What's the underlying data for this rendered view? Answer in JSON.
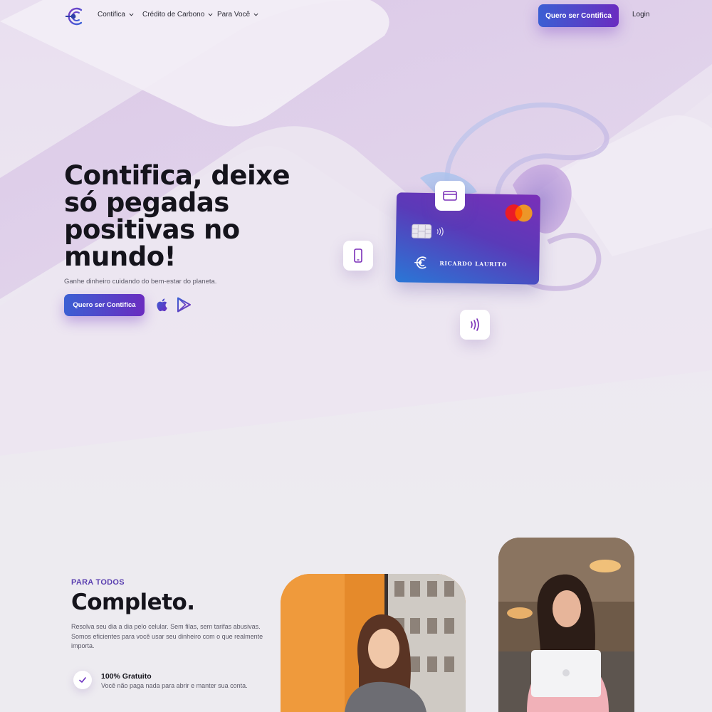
{
  "nav": {
    "menu": [
      {
        "label": "Contifica"
      },
      {
        "label": "Crédito de Carbono"
      },
      {
        "label": "Para Você"
      }
    ],
    "cta_label": "Quero ser Contifica",
    "login_label": "Login"
  },
  "hero": {
    "title": "Contifica, deixe só pegadas positivas no mundo!",
    "subtitle": "Ganhe dinheiro cuidando do bem-estar do planeta.",
    "cta_label": "Quero ser Contifica",
    "store_icons": [
      "apple-icon",
      "google-play-icon"
    ]
  },
  "card": {
    "holder_name": "RICARDO LAURITO",
    "network": "mastercard-icon"
  },
  "floating_icons": [
    "credit-card-icon",
    "smartphone-icon",
    "contactless-icon"
  ],
  "section": {
    "eyebrow": "PARA TODOS",
    "title": "Completo.",
    "body": "Resolva seu dia a dia pelo celular. Sem filas, sem tarifas abusivas. Somos eficientes para você usar seu dinheiro com o que realmente importa.",
    "feature": {
      "title": "100% Gratuito",
      "description": "Você não paga nada para abrir e manter sua conta."
    }
  },
  "colors": {
    "brand_purple": "#6a2cc0",
    "brand_blue": "#3b5fd3",
    "eyebrow": "#5a3fb0",
    "background": "#edebf0"
  }
}
